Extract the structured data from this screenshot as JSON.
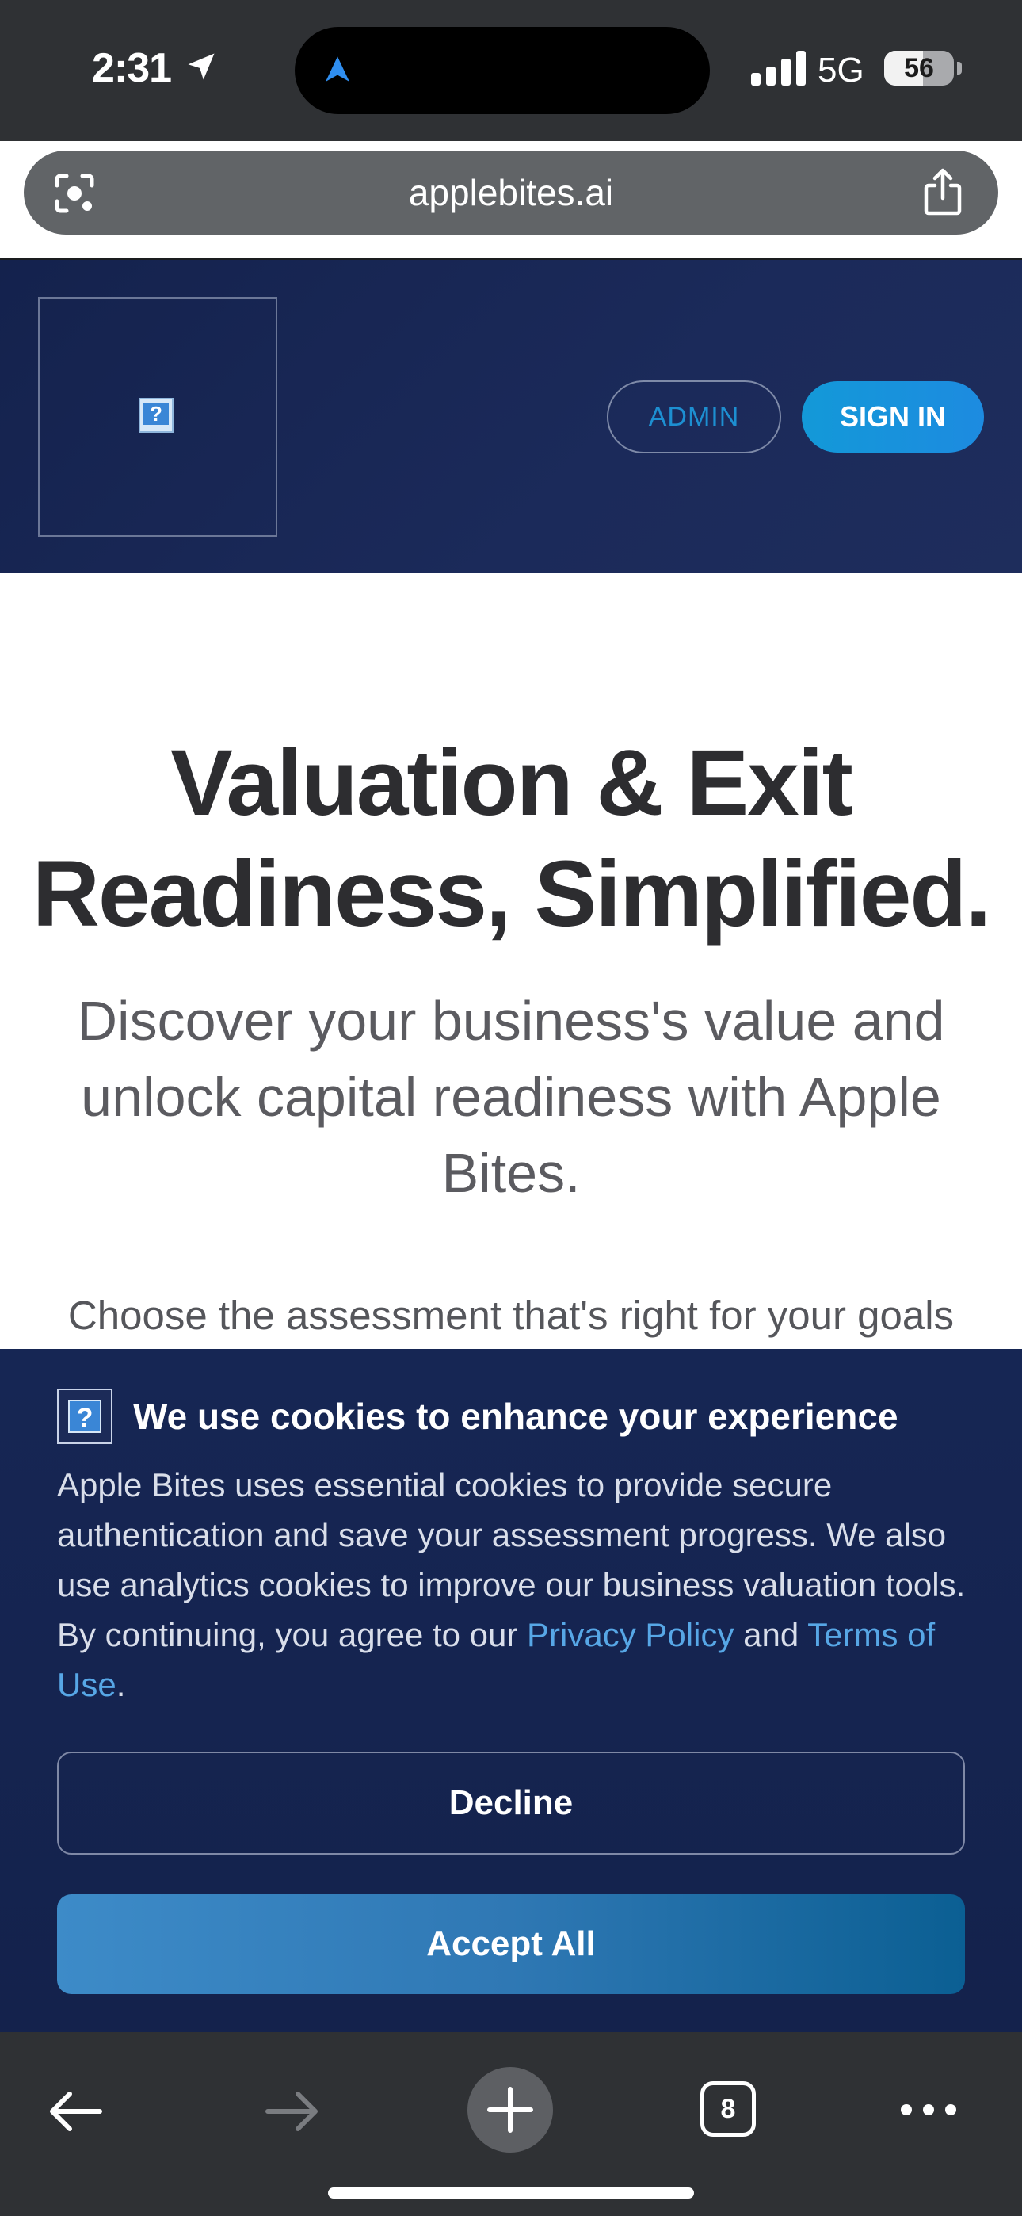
{
  "status_bar": {
    "time": "2:31",
    "network": "5G",
    "battery": "56",
    "battery_level": 0.56
  },
  "browser": {
    "url": "applebites.ai",
    "open_tabs": "8"
  },
  "header": {
    "admin_label": "ADMIN",
    "signin_label": "SIGN IN"
  },
  "hero": {
    "title_line1": "Valuation & Exit",
    "title_line2": "Readiness, Simplified.",
    "subtitle": "Discover your business's value and unlock capital readiness with Apple Bites.",
    "choose_prompt": "Choose the assessment that's right for your goals"
  },
  "cookie_banner": {
    "title": "We use cookies to enhance your experience",
    "body_prefix": "Apple Bites uses essential cookies to provide secure authentication and save your assessment progress. We also use analytics cookies to improve our business valuation tools. By continuing, you agree to our ",
    "privacy_link": "Privacy Policy",
    "and_text": " and ",
    "terms_link": "Terms of Use",
    "period": ".",
    "decline_label": "Decline",
    "accept_label": "Accept All"
  },
  "colors": {
    "header_bg": "#14224d",
    "accent": "#1d8be0",
    "link": "#57a7e6",
    "browser_chrome": "#2f3134"
  },
  "icons": [
    "location-arrow-icon",
    "navigation-arrow-icon",
    "signal-icon",
    "battery-icon",
    "lens-icon",
    "share-icon",
    "broken-image-icon",
    "back-icon",
    "forward-icon",
    "plus-icon",
    "tabs-icon",
    "more-icon"
  ]
}
